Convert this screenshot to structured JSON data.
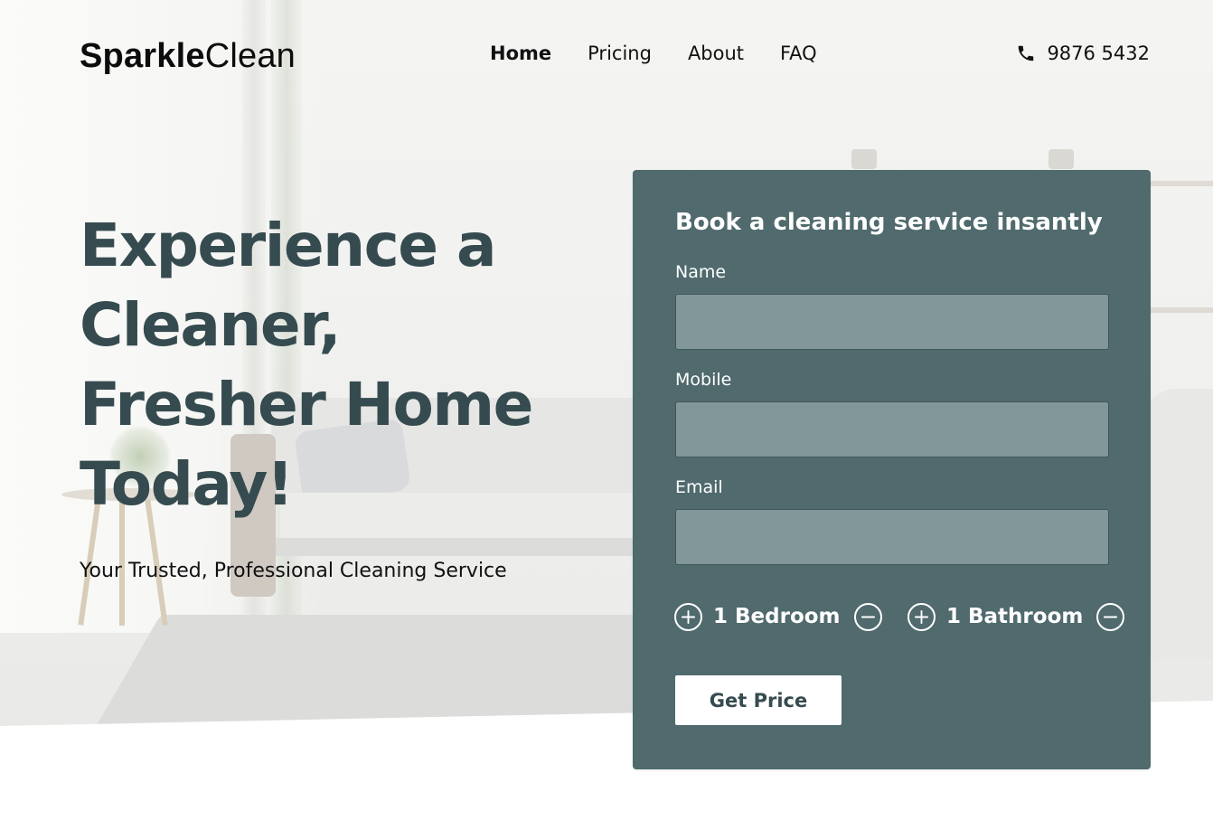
{
  "brand": {
    "name_bold": "Sparkle",
    "name_light": "Clean"
  },
  "nav": {
    "items": [
      {
        "label": "Home",
        "active": true
      },
      {
        "label": "Pricing",
        "active": false
      },
      {
        "label": "About",
        "active": false
      },
      {
        "label": "FAQ",
        "active": false
      }
    ]
  },
  "contact": {
    "icon": "phone-icon",
    "phone": "9876 5432"
  },
  "hero": {
    "headline_lines": [
      "Experience a",
      "Cleaner,",
      "Fresher Home",
      "Today!"
    ],
    "subheadline": "Your Trusted, Professional Cleaning Service"
  },
  "form": {
    "title": "Book a cleaning service insantly",
    "fields": [
      {
        "label": "Name",
        "value": "",
        "placeholder": ""
      },
      {
        "label": "Mobile",
        "value": "",
        "placeholder": ""
      },
      {
        "label": "Email",
        "value": "",
        "placeholder": ""
      }
    ],
    "bedroom": {
      "value": "1 Bedroom",
      "increment_icon": "plus-circle-icon",
      "decrement_icon": "minus-circle-icon"
    },
    "bathroom": {
      "value": "1 Bathroom",
      "increment_icon": "plus-circle-icon",
      "decrement_icon": "minus-circle-icon"
    },
    "submit_label": "Get Price"
  },
  "colors": {
    "heading": "#354b4f",
    "card_background": "#506a6d",
    "input_background": "#829799",
    "button_background": "#ffffff",
    "button_text": "#354b4f"
  }
}
